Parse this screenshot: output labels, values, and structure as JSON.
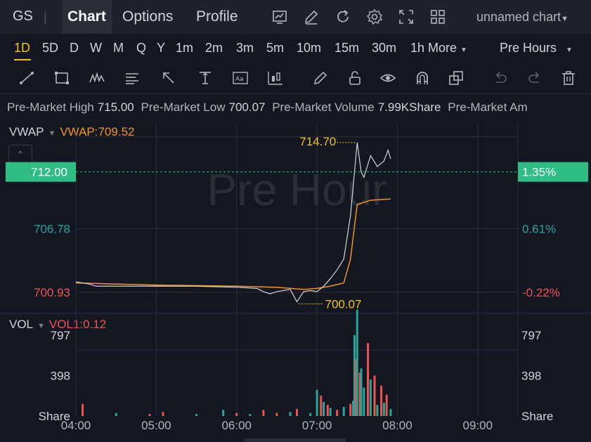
{
  "header": {
    "ticker": "GS",
    "separator": "|",
    "tabs": [
      {
        "label": "Chart"
      },
      {
        "label": "Options"
      },
      {
        "label": "Profile"
      }
    ],
    "chart_name": "unnamed chart",
    "icons": [
      "chart-type-icon",
      "draw-icon",
      "refresh-icon",
      "settings-icon",
      "fullscreen-icon",
      "layout-grid-icon"
    ]
  },
  "timeframes": {
    "items": [
      "1D",
      "5D",
      "D",
      "W",
      "M",
      "Q",
      "Y",
      "1m",
      "2m",
      "3m",
      "5m",
      "10m",
      "15m",
      "30m",
      "1h"
    ],
    "active": "1D",
    "more_label": "More",
    "session_label": "Pre Hours"
  },
  "toolbar": {
    "icons": [
      "trend-line-icon",
      "rectangle-icon",
      "pattern-icon",
      "fib-icon",
      "arrow-icon",
      "measure-icon",
      "text-icon",
      "candle-icon",
      "pencil-icon",
      "lock-icon",
      "eye-icon",
      "magnet-icon",
      "layers-icon",
      "undo-icon",
      "redo-icon",
      "trash-icon"
    ]
  },
  "infobar": {
    "items": [
      {
        "label": "Pre-Market High",
        "value": "715.00"
      },
      {
        "label": "Pre-Market Low",
        "value": "700.07"
      },
      {
        "label": "Pre-Market Volume",
        "value": "7.99KShare"
      },
      {
        "label": "Pre-Market Am",
        "value": ""
      }
    ]
  },
  "price_pane": {
    "indicator": "VWAP",
    "indicator_value": "VWAP:709.52",
    "watermark": "Pre Hour",
    "current_price_label": "712.00",
    "current_pct_label": "1.35%",
    "left_ticks": [
      "706.78",
      "700.93"
    ],
    "right_ticks": [
      "0.61%",
      "-0.22%"
    ],
    "high_label": "714.70",
    "low_label": "700.07",
    "colors": {
      "up": "#26a69a",
      "down": "#ef5350",
      "price_line": "#d1d4dc",
      "vwap": "#f7931a",
      "current": "#2ebd85",
      "annotation": "#f0c419"
    }
  },
  "volume_pane": {
    "indicator": "VOL",
    "indicator_value": "VOL1:0.12",
    "left_ticks": [
      "797",
      "398",
      "Share"
    ],
    "right_ticks": [
      "797",
      "398",
      "Share"
    ]
  },
  "x_axis": {
    "ticks": [
      "04:00",
      "05:00",
      "06:00",
      "07:00",
      "08:00",
      "09:00"
    ]
  },
  "chart_data": {
    "type": "line",
    "title": "",
    "x_unit": "time",
    "x_range": [
      "04:00",
      "09:30"
    ],
    "y_range": [
      699.0,
      716.5
    ],
    "reference_lines": {
      "current_price": 712.0,
      "high": 714.7,
      "low": 700.07
    },
    "series": [
      {
        "name": "price",
        "x": [
          "04:00",
          "04:10",
          "04:15",
          "04:30",
          "05:00",
          "05:30",
          "06:00",
          "06:15",
          "06:20",
          "06:25",
          "06:30",
          "06:40",
          "06:45",
          "06:50",
          "06:55",
          "07:00",
          "07:05",
          "07:10",
          "07:15",
          "07:20",
          "07:25",
          "07:30",
          "07:33",
          "07:35",
          "07:40",
          "07:45",
          "07:50",
          "07:53",
          "07:55"
        ],
        "values": [
          701.9,
          701.7,
          701.5,
          701.5,
          701.5,
          701.5,
          701.4,
          701.3,
          701.0,
          700.8,
          701.0,
          701.2,
          700.07,
          701.0,
          701.1,
          701.0,
          701.5,
          702.2,
          703.0,
          704.0,
          708.0,
          714.7,
          712.0,
          711.5,
          713.5,
          712.5,
          713.0,
          714.0,
          713.2
        ]
      },
      {
        "name": "VWAP",
        "x": [
          "04:00",
          "05:00",
          "06:00",
          "06:30",
          "06:50",
          "07:00",
          "07:10",
          "07:20",
          "07:25",
          "07:30",
          "07:40",
          "07:55"
        ],
        "values": [
          701.8,
          701.6,
          701.5,
          701.4,
          701.2,
          701.3,
          701.5,
          701.8,
          704.0,
          709.0,
          709.4,
          709.52
        ]
      }
    ],
    "volume": {
      "y_range": [
        0,
        1000
      ],
      "x": [
        "04:05",
        "04:30",
        "04:55",
        "05:05",
        "05:30",
        "05:50",
        "06:00",
        "06:10",
        "06:20",
        "06:30",
        "06:40",
        "06:45",
        "06:55",
        "07:00",
        "07:03",
        "07:05",
        "07:08",
        "07:10",
        "07:15",
        "07:20",
        "07:25",
        "07:27",
        "07:28",
        "07:29",
        "07:30",
        "07:32",
        "07:33",
        "07:35",
        "07:38",
        "07:40",
        "07:43",
        "07:45",
        "07:48",
        "07:50",
        "07:52",
        "07:55"
      ],
      "values": [
        120,
        30,
        20,
        40,
        20,
        60,
        30,
        20,
        60,
        30,
        40,
        70,
        30,
        260,
        200,
        140,
        110,
        80,
        60,
        90,
        120,
        150,
        800,
        560,
        1050,
        430,
        470,
        280,
        720,
        360,
        400,
        110,
        300,
        130,
        210,
        70
      ],
      "up": [
        false,
        true,
        false,
        false,
        true,
        true,
        false,
        true,
        false,
        false,
        true,
        false,
        true,
        true,
        false,
        true,
        false,
        true,
        false,
        true,
        false,
        true,
        true,
        false,
        true,
        false,
        true,
        true,
        false,
        true,
        false,
        true,
        false,
        true,
        false,
        true
      ]
    }
  }
}
